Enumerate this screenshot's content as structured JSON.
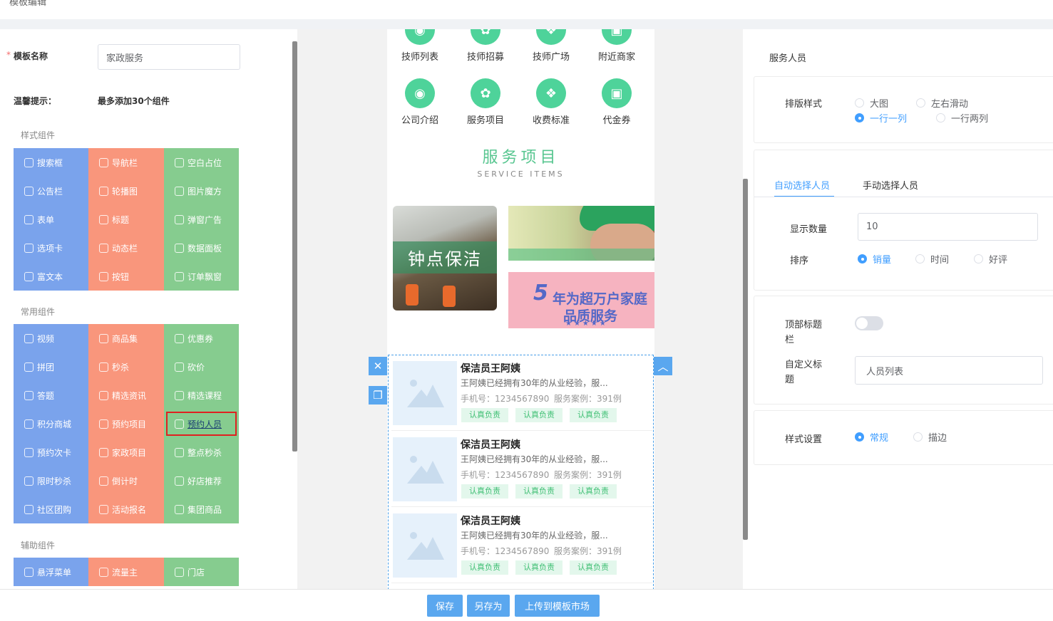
{
  "page_title": "模板编辑",
  "left": {
    "required_mark": "*",
    "template_name_label": "模板名称",
    "template_name_value": "家政服务",
    "tip_label": "温馨提示：",
    "tip_text": "最多添加30个组件",
    "style_section": "样式组件",
    "style_cols": [
      [
        "搜索框",
        "公告栏",
        "表单",
        "选项卡",
        "富文本"
      ],
      [
        "导航栏",
        "轮播图",
        "标题",
        "动态栏",
        "按钮"
      ],
      [
        "空白占位",
        "图片魔方",
        "弹窗广告",
        "数据面板",
        "订单飘窗"
      ]
    ],
    "common_section": "常用组件",
    "common_cols": [
      [
        "视频",
        "拼团",
        "答题",
        "积分商城",
        "预约次卡",
        "限时秒杀",
        "社区团购"
      ],
      [
        "商品集",
        "秒杀",
        "精选资讯",
        "预约项目",
        "家政项目",
        "倒计时",
        "活动报名"
      ],
      [
        "优惠券",
        "砍价",
        "精选课程",
        "预约人员",
        "整点秒杀",
        "好店推荐",
        "集团商品"
      ]
    ],
    "aux_section": "辅助组件",
    "aux_cols": [
      [
        "悬浮菜单"
      ],
      [
        "流量主"
      ],
      [
        "门店"
      ]
    ]
  },
  "phone": {
    "nav_row1": [
      "技师列表",
      "技师招募",
      "技师广场",
      "附近商家"
    ],
    "nav_row2": [
      "公司介绍",
      "服务项目",
      "收费标准",
      "代金券"
    ],
    "service_title": "服务项目",
    "service_sub": "SERVICE ITEMS",
    "banner_left_text": "钟点保洁",
    "banner_promo_num": "5",
    "banner_promo_line1": "年为超万户家庭",
    "banner_promo_line2": "品质服务",
    "staff": [
      {
        "name": "保洁员王阿姨",
        "desc": "王阿姨已经拥有30年的从业经验，服...",
        "phone": "手机号：1234567890",
        "cases": "服务案例：391例",
        "tags": [
          "认真负责",
          "认真负责",
          "认真负责"
        ]
      },
      {
        "name": "保洁员王阿姨",
        "desc": "王阿姨已经拥有30年的从业经验，服...",
        "phone": "手机号：1234567890",
        "cases": "服务案例：391例",
        "tags": [
          "认真负责",
          "认真负责",
          "认真负责"
        ]
      },
      {
        "name": "保洁员王阿姨",
        "desc": "王阿姨已经拥有30年的从业经验，服...",
        "phone": "手机号：1234567890",
        "cases": "服务案例：391例",
        "tags": [
          "认真负责",
          "认真负责",
          "认真负责"
        ]
      }
    ]
  },
  "right": {
    "title": "服务人员",
    "layout_label": "排版样式",
    "layout_options": [
      "大图",
      "左右滑动",
      "一行一列",
      "一行两列"
    ],
    "layout_selected": "一行一列",
    "tab_auto": "自动选择人员",
    "tab_manual": "手动选择人员",
    "count_label": "显示数量",
    "count_value": "10",
    "sort_label": "排序",
    "sort_options": [
      "销量",
      "时间",
      "好评"
    ],
    "sort_selected": "销量",
    "top_title_label_1": "顶部标题",
    "top_title_label_2": "栏",
    "custom_title_label_1": "自定义标",
    "custom_title_label_2": "题",
    "custom_title_value": "人员列表",
    "style_label": "样式设置",
    "style_options": [
      "常规",
      "描边"
    ],
    "style_selected": "常规"
  },
  "buttons": {
    "save": "保存",
    "save_as": "另存为",
    "upload": "上传到模板市场"
  },
  "colors": {
    "accent": "#409eff",
    "style_blue": "#7aa3ec",
    "style_orange": "#f9967c",
    "style_green": "#86cc8f",
    "brand_green": "#4ed39a"
  }
}
